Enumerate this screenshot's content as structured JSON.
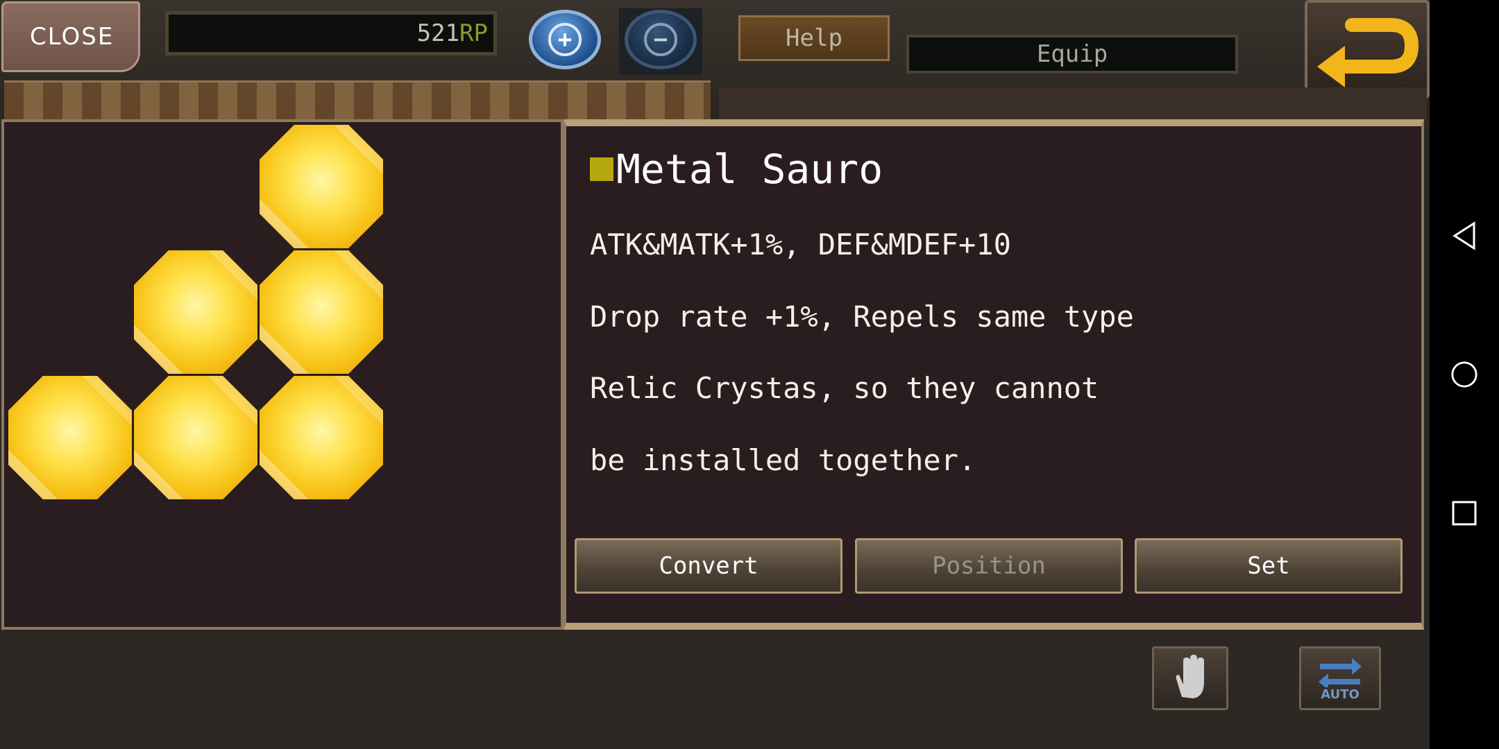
{
  "header": {
    "close_label": "CLOSE",
    "rp_value": "521",
    "rp_unit": "RP",
    "help_label": "Help",
    "equip_label": "Equip"
  },
  "info": {
    "title": "Metal Sauro",
    "lines": [
      "ATK&MATK+1%, DEF&MDEF+10",
      "Drop rate +1%, Repels same type",
      "Relic Crystas, so they cannot",
      "be installed together."
    ]
  },
  "actions": {
    "convert_label": "Convert",
    "position_label": "Position",
    "set_label": "Set"
  },
  "bottom": {
    "auto_label": "AUTO"
  },
  "colors": {
    "title_marker": "#b5a90f",
    "rp_unit": "#8c9a2d",
    "gem": "#ffe14a"
  }
}
